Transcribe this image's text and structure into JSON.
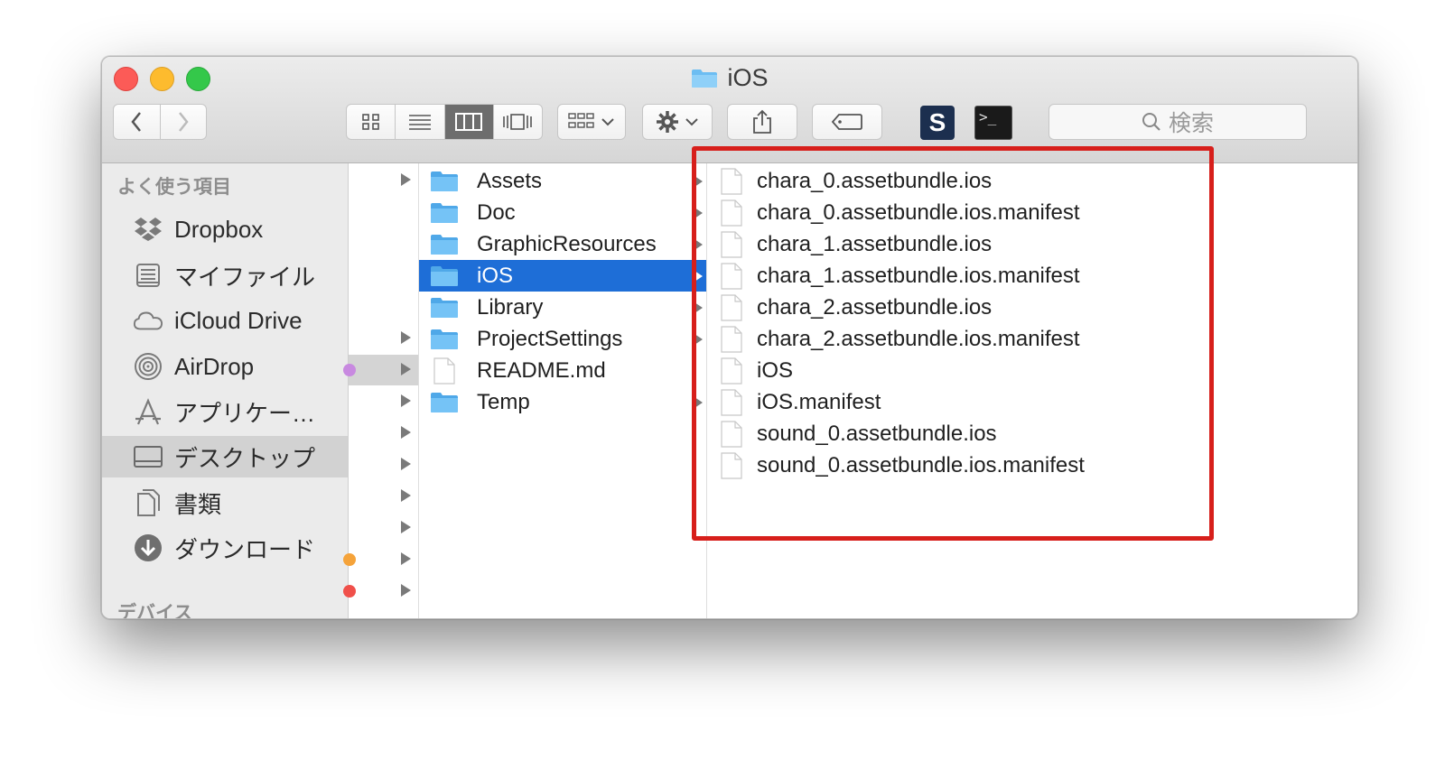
{
  "window": {
    "title": "iOS"
  },
  "toolbar": {
    "search_placeholder": "検索"
  },
  "sidebar": {
    "header_favorites": "よく使う項目",
    "header_devices": "デバイス",
    "items": [
      {
        "label": "Dropbox",
        "icon": "dropbox-icon"
      },
      {
        "label": "マイファイル",
        "icon": "my-files-icon"
      },
      {
        "label": "iCloud Drive",
        "icon": "cloud-icon"
      },
      {
        "label": "AirDrop",
        "icon": "airdrop-icon"
      },
      {
        "label": "アプリケー…",
        "icon": "applications-icon"
      },
      {
        "label": "デスクトップ",
        "icon": "desktop-icon",
        "selected": true
      },
      {
        "label": "書類",
        "icon": "documents-icon"
      },
      {
        "label": "ダウンロード",
        "icon": "download-icon"
      }
    ]
  },
  "folder_column": {
    "items": [
      {
        "name": "Assets",
        "type": "folder"
      },
      {
        "name": "Doc",
        "type": "folder"
      },
      {
        "name": "GraphicResources",
        "type": "folder"
      },
      {
        "name": "iOS",
        "type": "folder",
        "selected": true
      },
      {
        "name": "Library",
        "type": "folder"
      },
      {
        "name": "ProjectSettings",
        "type": "folder"
      },
      {
        "name": "README.md",
        "type": "file"
      },
      {
        "name": "Temp",
        "type": "folder"
      }
    ]
  },
  "files_column": {
    "items": [
      "chara_0.assetbundle.ios",
      "chara_0.assetbundle.ios.manifest",
      "chara_1.assetbundle.ios",
      "chara_1.assetbundle.ios.manifest",
      "chara_2.assetbundle.ios",
      "chara_2.assetbundle.ios.manifest",
      "iOS",
      "iOS.manifest",
      "sound_0.assetbundle.ios",
      "sound_0.assetbundle.ios.manifest"
    ]
  },
  "colors": {
    "selection": "#1e6ed7",
    "folder": "#5fb6f2",
    "highlight_box": "#d71f1b"
  }
}
